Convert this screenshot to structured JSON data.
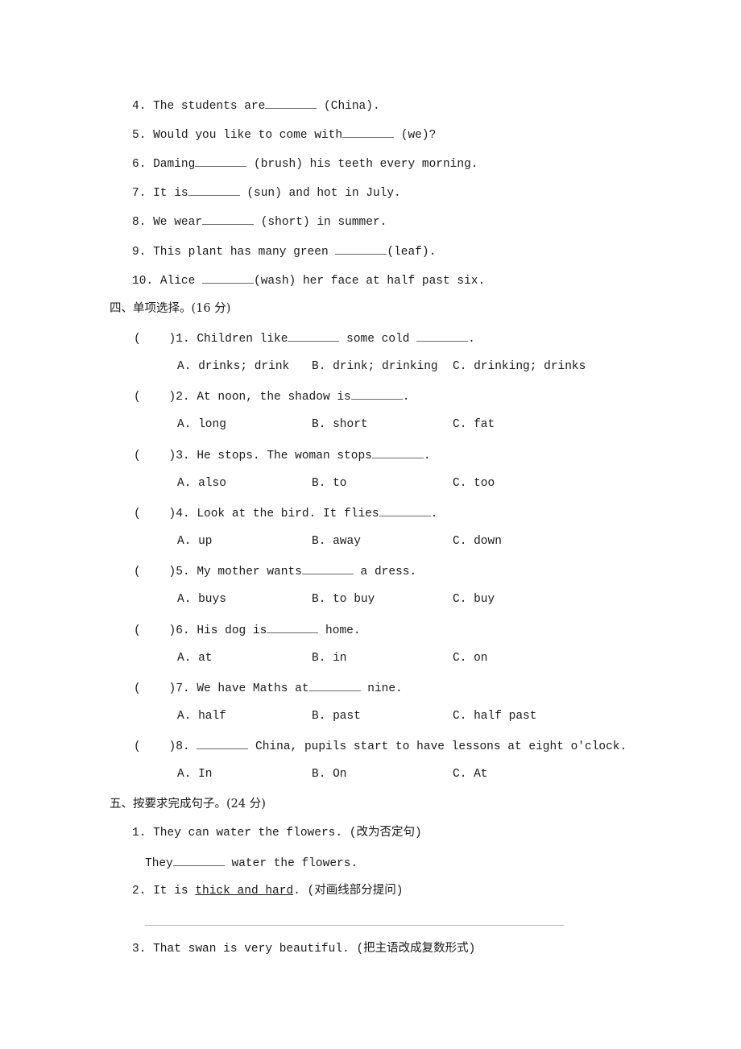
{
  "part3_items": [
    {
      "num": "4.",
      "before": "The students are",
      "after": " (China)."
    },
    {
      "num": "5.",
      "before": "Would you like to come with",
      "after": " (we)?"
    },
    {
      "num": "6.",
      "before": "Daming",
      "after": " (brush) his teeth every morning."
    },
    {
      "num": "7.",
      "before": "It is",
      "after": " (sun) and hot in July."
    },
    {
      "num": "8.",
      "before": "We wear",
      "after": " (short) in summer."
    },
    {
      "num": "9.",
      "before": "This plant has many green ",
      "after": "(leaf)."
    },
    {
      "num": "10.",
      "before": "Alice ",
      "after": "(wash) her face at half past six."
    }
  ],
  "section4": {
    "title": "四、单项选择。(16 分)",
    "questions": [
      {
        "stem_before": ")1. Children like",
        "stem_mid": " some cold ",
        "stem_after": ".",
        "options": [
          "A. drinks; drink",
          "B. drink; drinking",
          "C. drinking; drinks"
        ]
      },
      {
        "stem_before": ")2. At noon, the shadow is",
        "stem_after": ".",
        "options": [
          "A. long",
          "B. short",
          "C. fat"
        ]
      },
      {
        "stem_before": ")3. He stops. The woman stops",
        "stem_after": ".",
        "options": [
          "A. also",
          "B. to",
          "C. too"
        ]
      },
      {
        "stem_before": ")4. Look at the bird. It flies",
        "stem_after": ".",
        "options": [
          "A. up",
          "B. away",
          "C. down"
        ]
      },
      {
        "stem_before": ")5. My mother wants",
        "stem_after": " a dress.",
        "options": [
          "A. buys",
          "B. to buy",
          "C. buy"
        ]
      },
      {
        "stem_before": ")6. His dog is",
        "stem_after": " home.",
        "options": [
          "A. at",
          "B. in",
          "C. on"
        ]
      },
      {
        "stem_before": ")7. We have Maths at",
        "stem_after": " nine.",
        "options": [
          "A. half",
          "B. past",
          "C. half past"
        ]
      },
      {
        "stem_before": ")8. ",
        "stem_after": " China, pupils start to have lessons at eight o'clock.",
        "options": [
          "A. In",
          "B. On",
          "C. At"
        ]
      }
    ],
    "paren_open": "("
  },
  "section5": {
    "title": "五、按要求完成句子。(24 分)",
    "q1": {
      "text": "1. They can water the flowers. (改为否定句)",
      "answer_before": "They",
      "answer_after": " water the flowers."
    },
    "q2": {
      "before": "2. It is ",
      "underlined": "thick and hard",
      "after": ". (对画线部分提问)"
    },
    "q3": {
      "text": "3. That swan is very beautiful. (把主语改成复数形式)"
    }
  }
}
